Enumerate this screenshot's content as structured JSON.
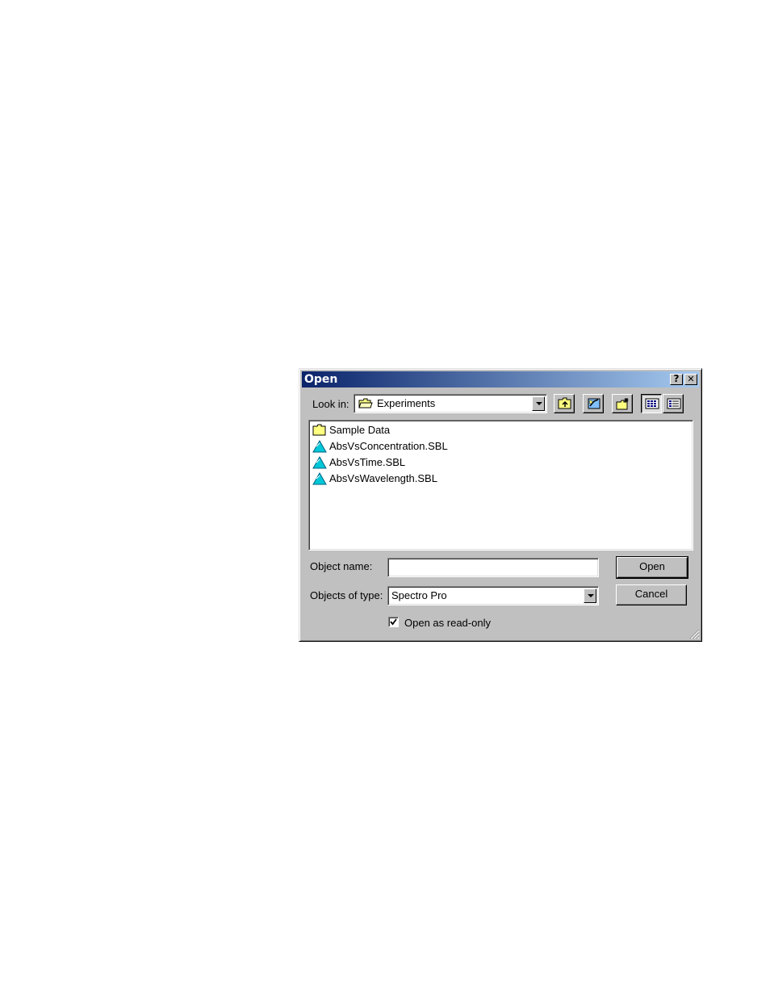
{
  "dialog": {
    "title": "Open",
    "help_label": "?",
    "close_label": "✕"
  },
  "look_in": {
    "label": "Look in:",
    "value": "Experiments"
  },
  "toolbar": {
    "icons": [
      "up-one-level-icon",
      "desktop-icon",
      "new-folder-icon",
      "list-view-icon",
      "details-view-icon"
    ]
  },
  "files": [
    {
      "name": "Sample Data",
      "icon": "folder-icon"
    },
    {
      "name": "AbsVsConcentration.SBL",
      "icon": "experiment-file-icon"
    },
    {
      "name": "AbsVsTime.SBL",
      "icon": "experiment-file-icon"
    },
    {
      "name": "AbsVsWavelength.SBL",
      "icon": "experiment-file-icon"
    }
  ],
  "object_name": {
    "label": "Object name:",
    "value": ""
  },
  "objects_of_type": {
    "label": "Objects of type:",
    "value": "Spectro Pro"
  },
  "buttons": {
    "open_label": "Open",
    "cancel_label": "Cancel"
  },
  "read_only": {
    "label": "Open as read-only",
    "checked": true
  },
  "colors": {
    "titlebar_start": "#0a246a",
    "titlebar_end": "#a6caf0",
    "face": "#c0c0c0",
    "file_icon": "#00c8d8",
    "folder_icon": "#ffff80"
  }
}
